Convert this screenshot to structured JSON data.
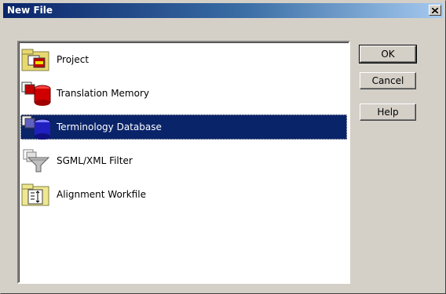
{
  "window": {
    "title": "New File"
  },
  "list": {
    "items": [
      {
        "label": "Project",
        "icon": "project-icon",
        "selected": false
      },
      {
        "label": "Translation Memory",
        "icon": "translation-memory-icon",
        "selected": false
      },
      {
        "label": "Terminology Database",
        "icon": "terminology-database-icon",
        "selected": true
      },
      {
        "label": "SGML/XML Filter",
        "icon": "filter-icon",
        "selected": false
      },
      {
        "label": "Alignment Workfile",
        "icon": "alignment-workfile-icon",
        "selected": false
      }
    ]
  },
  "buttons": {
    "ok": "OK",
    "cancel": "Cancel",
    "help": "Help"
  },
  "colors": {
    "selection": "#0a246a",
    "title_start": "#0a246a",
    "title_end": "#a6caf0",
    "face": "#d4d0c8"
  }
}
